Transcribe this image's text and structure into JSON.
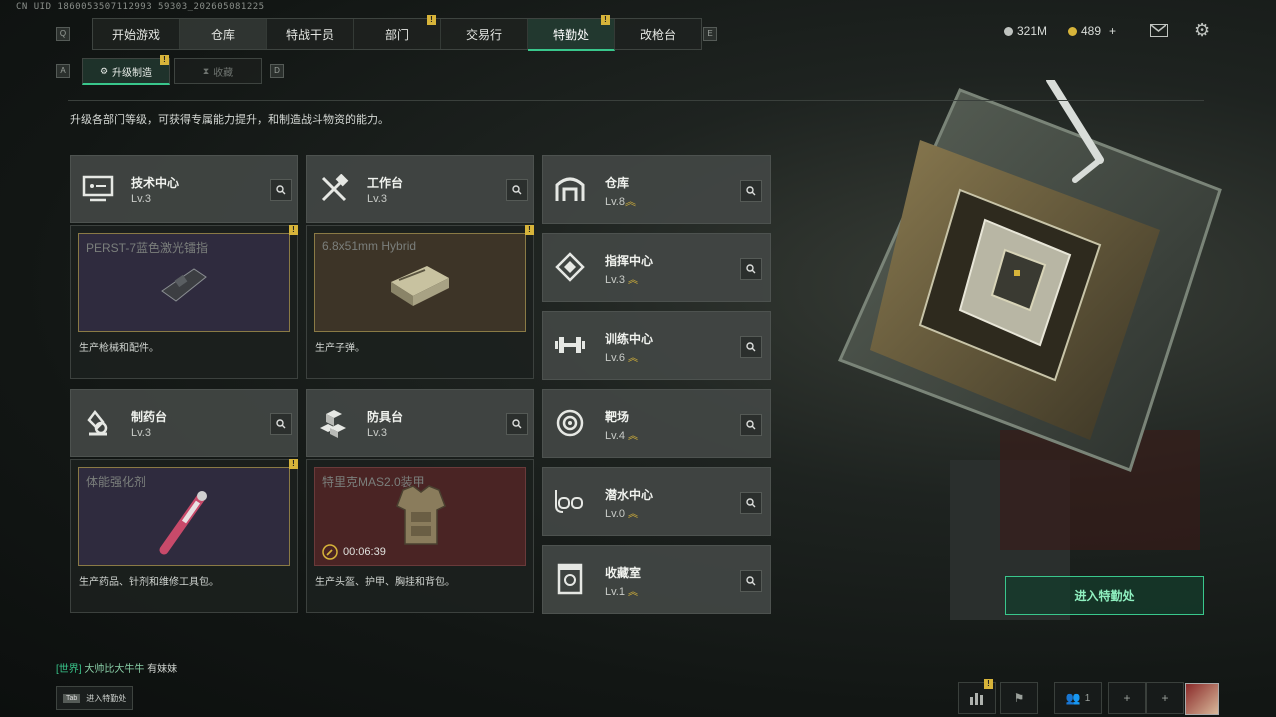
{
  "uid": "CN UID 1860053507112993 59303_202605081225",
  "nav": {
    "key_left": "Q",
    "key_right": "E",
    "tabs": [
      {
        "label": "开始游戏",
        "state": "normal"
      },
      {
        "label": "仓库",
        "state": "dim"
      },
      {
        "label": "特战干员",
        "state": "normal"
      },
      {
        "label": "部门",
        "state": "normal",
        "badge": "!"
      },
      {
        "label": "交易行",
        "state": "normal"
      },
      {
        "label": "特勤处",
        "state": "active",
        "badge": "!"
      },
      {
        "label": "改枪台",
        "state": "normal"
      }
    ]
  },
  "subnav": {
    "key_left": "A",
    "key_right": "D",
    "upgrade": "升级制造",
    "upgrade_badge": "!",
    "collection": "收藏"
  },
  "currency": {
    "silver": "321M",
    "gold": "489",
    "gold_plus": "+"
  },
  "description": "升级各部门等级，可获得专属能力提升，和制造战斗物资的能力。",
  "departments": [
    {
      "name": "技术中心",
      "level": "Lv.3",
      "icon": "tech-center-icon",
      "product": "PERST-7蓝色激光镭指",
      "product_desc": "生产枪械和配件。",
      "badge": "!"
    },
    {
      "name": "工作台",
      "level": "Lv.3",
      "icon": "workbench-icon",
      "product": "6.8x51mm Hybrid",
      "product_desc": "生产子弹。",
      "badge": "!"
    },
    {
      "name": "制药台",
      "level": "Lv.3",
      "icon": "pharmacy-icon",
      "product": "体能强化剂",
      "product_desc": "生产药品、针剂和维修工具包。",
      "badge": "!"
    },
    {
      "name": "防具台",
      "level": "Lv.3",
      "icon": "armor-bench-icon",
      "product": "特里克MAS2.0装甲",
      "product_desc": "生产头盔、护甲、胸挂和背包。",
      "timer": "00:06:39"
    }
  ],
  "facilities": [
    {
      "name": "仓库",
      "level": "Lv.8",
      "icon": "warehouse-icon"
    },
    {
      "name": "指挥中心",
      "level": "Lv.3",
      "icon": "command-center-icon"
    },
    {
      "name": "训练中心",
      "level": "Lv.6",
      "icon": "training-center-icon"
    },
    {
      "name": "靶场",
      "level": "Lv.4",
      "icon": "shooting-range-icon"
    },
    {
      "name": "潜水中心",
      "level": "Lv.0",
      "icon": "diving-center-icon"
    },
    {
      "name": "收藏室",
      "level": "Lv.1",
      "icon": "collection-room-icon"
    }
  ],
  "enter_button": "进入特勤处",
  "chat": {
    "channel": "[世界]",
    "sender": "大帅比大牛牛",
    "message": "有妹妹"
  },
  "tab_hint": {
    "key": "Tab",
    "label": "进入特勤处"
  },
  "bottom": {
    "stats_badge": "!",
    "party_count": "1",
    "plus": "+"
  },
  "colors": {
    "accent": "#39c78c",
    "badge": "#d7b43a",
    "panel": "#424744"
  }
}
